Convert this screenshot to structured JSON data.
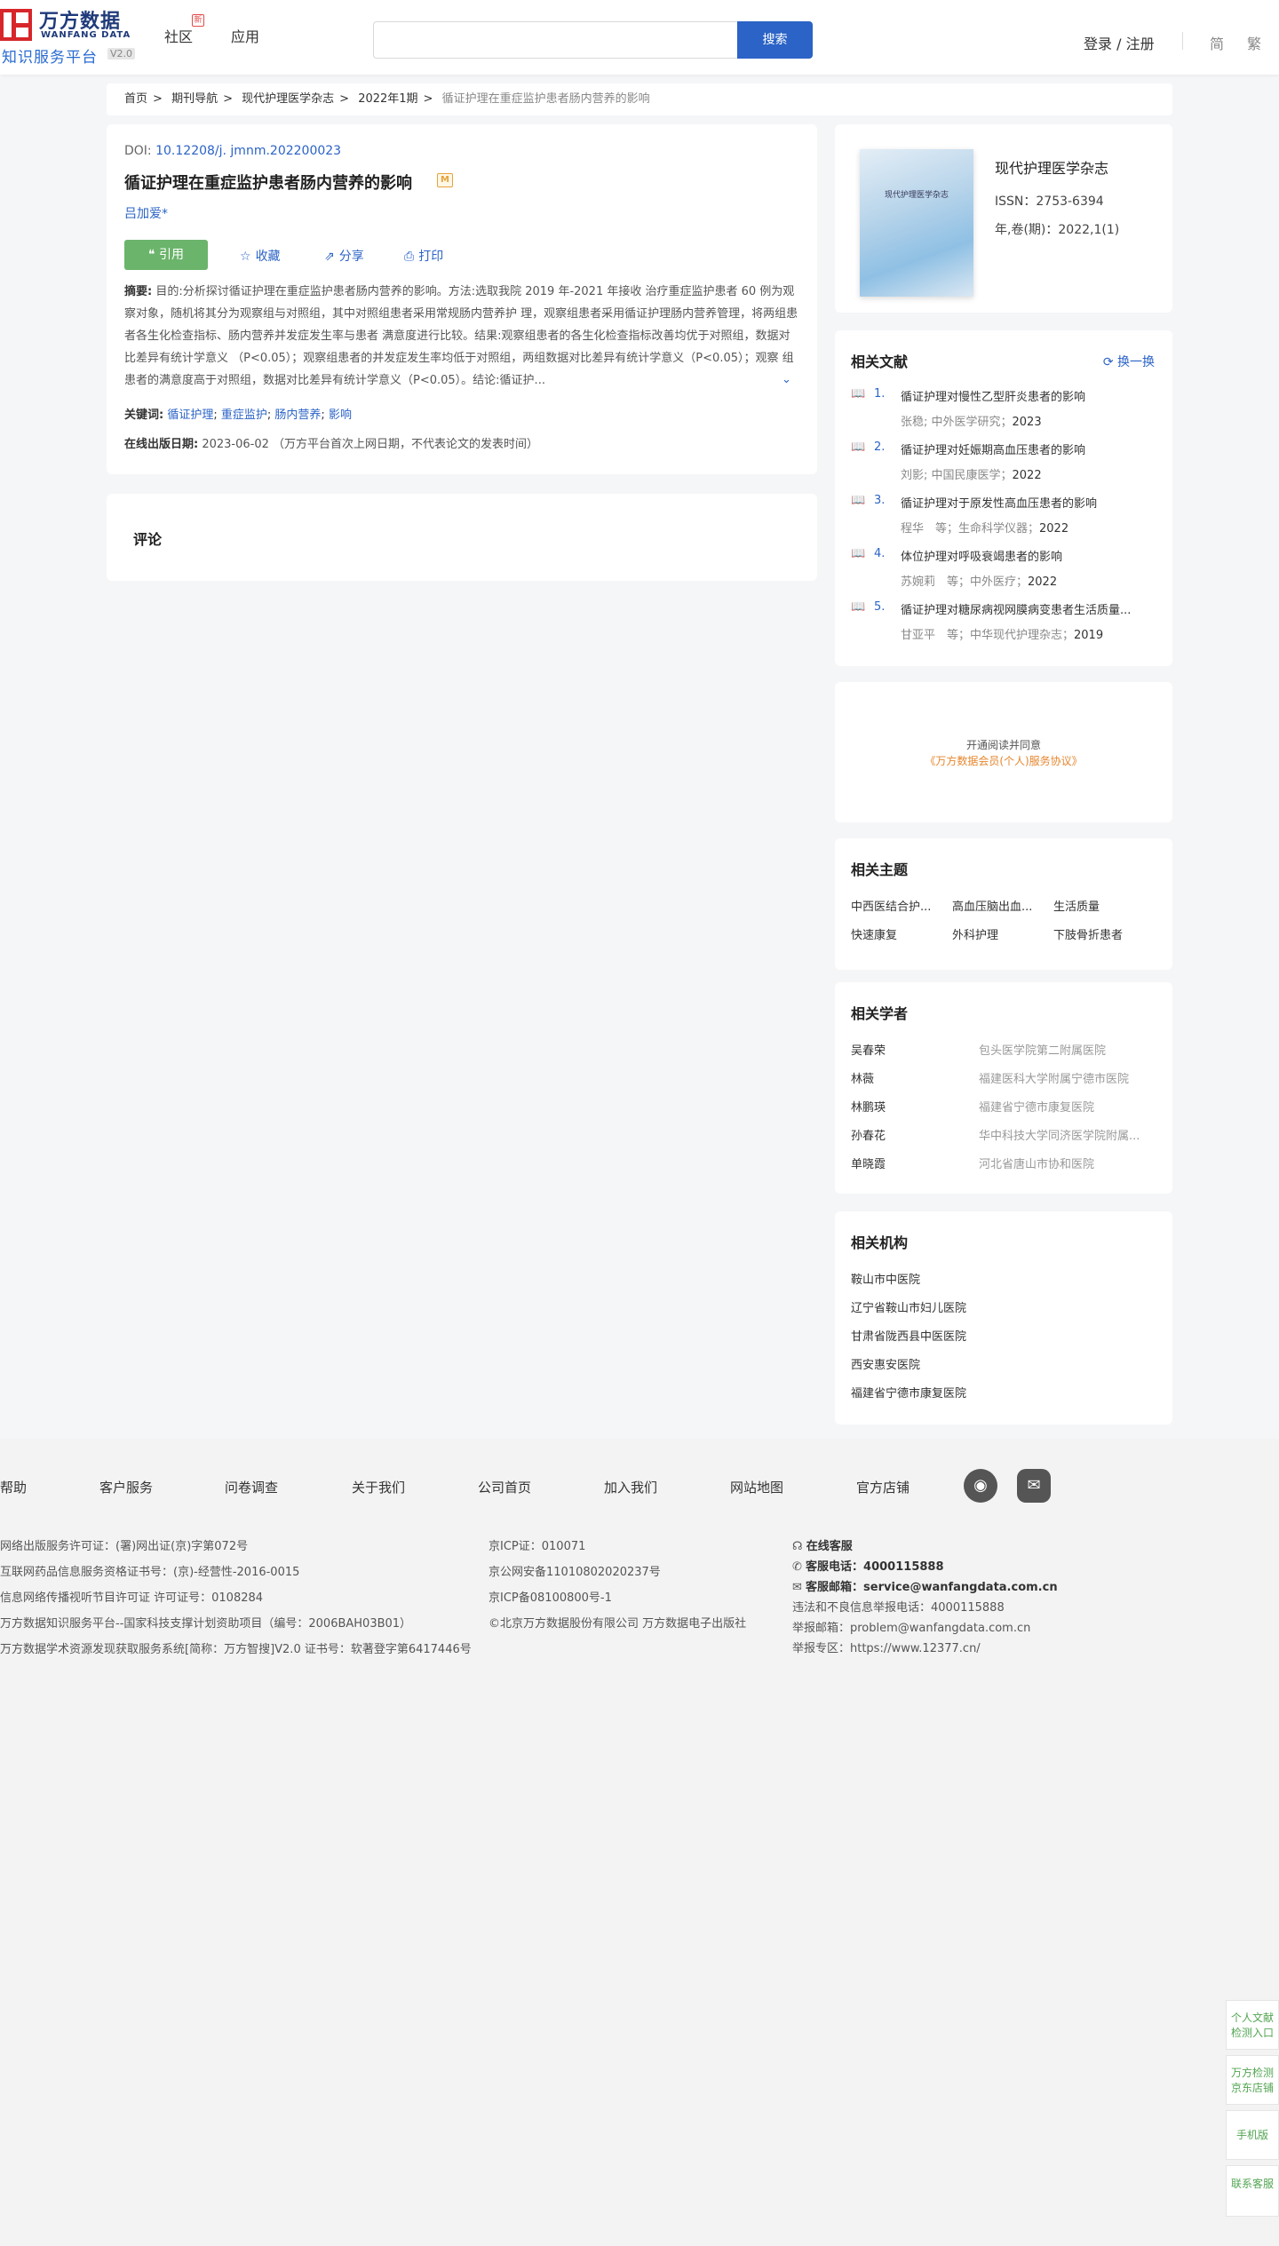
{
  "header": {
    "logo_cn": "万方数据",
    "logo_en": "WANFANG DATA",
    "logo_sub": "知识服务平台",
    "logo_ver": "V2.0",
    "nav": [
      "社区",
      "应用"
    ],
    "badge": "新",
    "search_placeholder": "",
    "search_btn": "搜索",
    "login": "登录 / 注册",
    "lang_simple": "简",
    "lang_trad": "繁"
  },
  "breadcrumb": {
    "items": [
      "首页",
      "期刊导航",
      "现代护理医学杂志",
      "2022年1期"
    ],
    "current": "循证护理在重症监护患者肠内营养的影响"
  },
  "article": {
    "doi_label": "DOI:",
    "doi": "10.12208/j. jmnm.202200023",
    "title": "循证护理在重症监护患者肠内营养的影响",
    "m_badge": "M",
    "author": "吕加爱*",
    "cite": "引用",
    "collect": "收藏",
    "share": "分享",
    "print": "打印",
    "abstract_label": "摘要:",
    "abstract": "目的:分析探讨循证护理在重症监护患者肠内营养的影响。方法:选取我院 2019 年-2021 年接收 治疗重症监护患者 60 例为观察对象，随机将其分为观察组与对照组，其中对照组患者采用常规肠内营养护 理，观察组患者采用循证护理肠内营养管理，将两组患者各生化检查指标、肠内营养并发症发生率与患者 满意度进行比较。结果:观察组患者的各生化检查指标改善均优于对照组，数据对比差异有统计学意义 （P<0.05）；观察组患者的并发症发生率均低于对照组，两组数据对比差异有统计学意义（P<0.05）；观察 组患者的满意度高于对照组，数据对比差异有统计学意义（P<0.05）。结论:循证护...",
    "keywords_label": "关键词:",
    "keywords": [
      "循证护理",
      "重症监护",
      "肠内营养",
      "影响"
    ],
    "pubdate_label": "在线出版日期:",
    "pubdate": "2023-06-02 （万方平台首次上网日期，不代表论文的发表时间）"
  },
  "comment": {
    "title": "评论"
  },
  "journal": {
    "cover_title": "现代护理医学杂志",
    "name": "现代护理医学杂志",
    "issn": "ISSN：2753-6394",
    "year": "年,卷(期)：2022,1(1)"
  },
  "related": {
    "title": "相关文献",
    "swap": "换一换",
    "items": [
      {
        "num": "1.",
        "title": "循证护理对慢性乙型肝炎患者的影响",
        "meta": "张稳; 中外医学研究；",
        "year": "2023"
      },
      {
        "num": "2.",
        "title": "循证护理对妊娠期高血压患者的影响",
        "meta": "刘影; 中国民康医学；",
        "year": "2022"
      },
      {
        "num": "3.",
        "title": "循证护理对于原发性高血压患者的影响",
        "meta": "程华　等；生命科学仪器；",
        "year": "2022"
      },
      {
        "num": "4.",
        "title": "体位护理对呼吸衰竭患者的影响",
        "meta": "苏婉莉　等；中外医疗；",
        "year": "2022"
      },
      {
        "num": "5.",
        "title": "循证护理对糖尿病视网膜病变患者生活质量...",
        "meta": "甘亚平　等；中华现代护理杂志；",
        "year": "2019"
      }
    ]
  },
  "open": {
    "line1": "开通阅读并同意",
    "line2": "《万方数据会员(个人)服务协议》"
  },
  "topics": {
    "title": "相关主题",
    "items": [
      "中西医结合护...",
      "高血压脑出血...",
      "生活质量",
      "快速康复",
      "外科护理",
      "下肢骨折患者"
    ]
  },
  "scholars": {
    "title": "相关学者",
    "items": [
      {
        "name": "吴春荣",
        "org": "包头医学院第二附属医院"
      },
      {
        "name": "林薇",
        "org": "福建医科大学附属宁德市医院"
      },
      {
        "name": "林鹏瑛",
        "org": "福建省宁德市康复医院"
      },
      {
        "name": "孙春花",
        "org": "华中科技大学同济医学院附属..."
      },
      {
        "name": "单晓霞",
        "org": "河北省唐山市协和医院"
      }
    ]
  },
  "orgs": {
    "title": "相关机构",
    "items": [
      "鞍山市中医院",
      "辽宁省鞍山市妇儿医院",
      "甘肃省陇西县中医医院",
      "西安惠安医院",
      "福建省宁德市康复医院"
    ]
  },
  "footer": {
    "nav": [
      "帮助",
      "客户服务",
      "问卷调查",
      "关于我们",
      "公司首页",
      "加入我们",
      "网站地图",
      "官方店铺"
    ],
    "col1": [
      "网络出版服务许可证：(署)网出证(京)字第072号",
      "互联网药品信息服务资格证书号：(京)-经营性-2016-0015",
      "信息网络传播视听节目许可证 许可证号：0108284",
      "万方数据知识服务平台--国家科技支撑计划资助项目（编号：2006BAH03B01）",
      "万方数据学术资源发现获取服务系统[简称：万方智搜]V2.0 证书号：软著登字第6417446号"
    ],
    "col2": [
      "京ICP证：010071",
      "京公网安备11010802020237号",
      "京ICP备08100800号-1",
      "©北京万方数据股份有限公司 万方数据电子出版社"
    ],
    "online": "在线客服",
    "phone_label": "客服电话：",
    "phone": "4000115888",
    "email_label": "客服邮箱：",
    "email": "service@wanfangdata.com.cn",
    "report_phone": "违法和不良信息举报电话：4000115888",
    "report_mail": "举报邮箱：problem@wanfangdata.com.cn",
    "report_zone": "举报专区：https://www.12377.cn/"
  },
  "float": {
    "f1": "个人文献检测入口",
    "f2": "万方检测京东店铺",
    "f3": "手机版",
    "f4": "联系客服"
  }
}
